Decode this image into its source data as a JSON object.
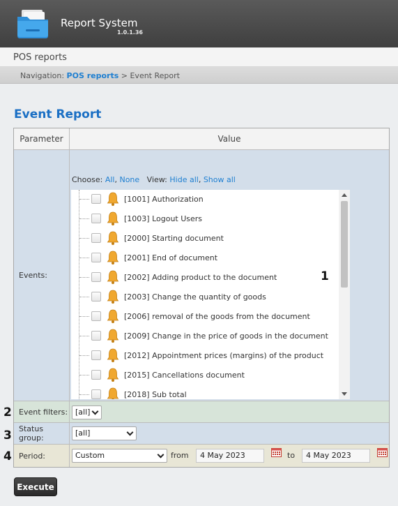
{
  "app": {
    "title": "Report System",
    "version": "1.0.1.36"
  },
  "section_title": "POS reports",
  "breadcrumb": {
    "prefix": "Navigation:",
    "link": "POS reports",
    "separator": ">",
    "current": "Event Report"
  },
  "report": {
    "title": "Event Report"
  },
  "table": {
    "col_parameter": "Parameter",
    "col_value": "Value"
  },
  "events": {
    "label": "Events:",
    "choose_label": "Choose:",
    "choose_all": "All",
    "choose_none": "None",
    "view_label": "View:",
    "hide_all": "Hide all",
    "show_all": "Show all",
    "items": [
      "[1001] Authorization",
      "[1003] Logout Users",
      "[2000] Starting document",
      "[2001] End of document",
      "[2002] Adding product to the document",
      "[2003] Change the quantity of goods",
      "[2006] removal of the goods from the document",
      "[2009] Change in the price of goods in the document",
      "[2012] Appointment prices (margins) of the product",
      "[2015] Cancellations document",
      "[2018] Sub total"
    ]
  },
  "event_filters": {
    "label": "Event filters:",
    "value": "[all]"
  },
  "status_group": {
    "label": "Status group:",
    "value": "[all]"
  },
  "period": {
    "label": "Period:",
    "value": "Custom",
    "from_label": "from",
    "from": "4 May 2023",
    "to_label": "to",
    "to": "4 May 2023"
  },
  "markers": {
    "m1": "1",
    "m2": "2",
    "m3": "3",
    "m4": "4"
  },
  "execute_label": "Execute",
  "colors": {
    "accent": "#1a6fc4",
    "link": "#1e7fd1",
    "bell": "#f0a830"
  }
}
